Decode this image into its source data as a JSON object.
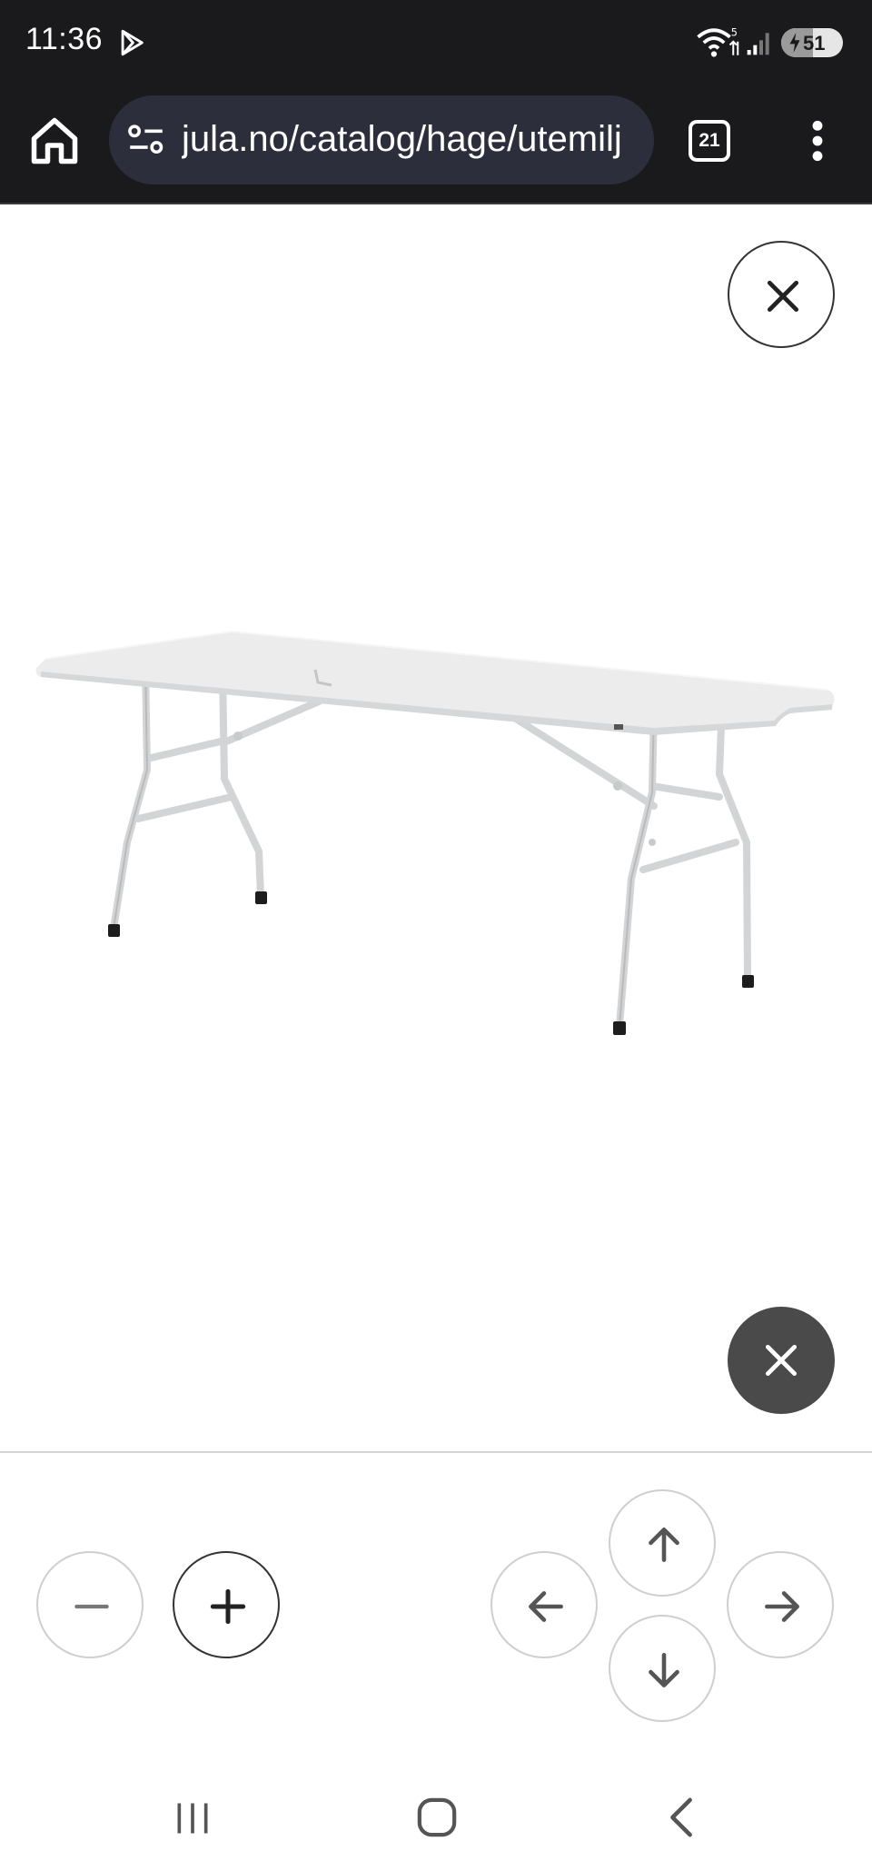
{
  "status_bar": {
    "time": "11:36",
    "battery": "51",
    "battery_level_percent": 51,
    "icons": [
      "play-store-icon",
      "wifi-icon",
      "signal-icon",
      "battery-icon"
    ]
  },
  "browser": {
    "url": "jula.no/catalog/hage/utemilj",
    "tab_count": "21",
    "icons": [
      "home-icon",
      "site-settings-icon",
      "more-vert-icon"
    ]
  },
  "viewer": {
    "image_subject": "folding-table",
    "close_icons": [
      "close-icon"
    ],
    "zoom_controls": [
      "minus-icon",
      "plus-icon"
    ],
    "pan_controls": [
      "arrow-up-icon",
      "arrow-left-icon",
      "arrow-right-icon",
      "arrow-down-icon"
    ]
  },
  "colors": {
    "system_bar": "#1a1a1d",
    "url_pill": "#2c2f3b",
    "close_filled": "#4a4a4a",
    "control_border": "#cfcfcf"
  }
}
